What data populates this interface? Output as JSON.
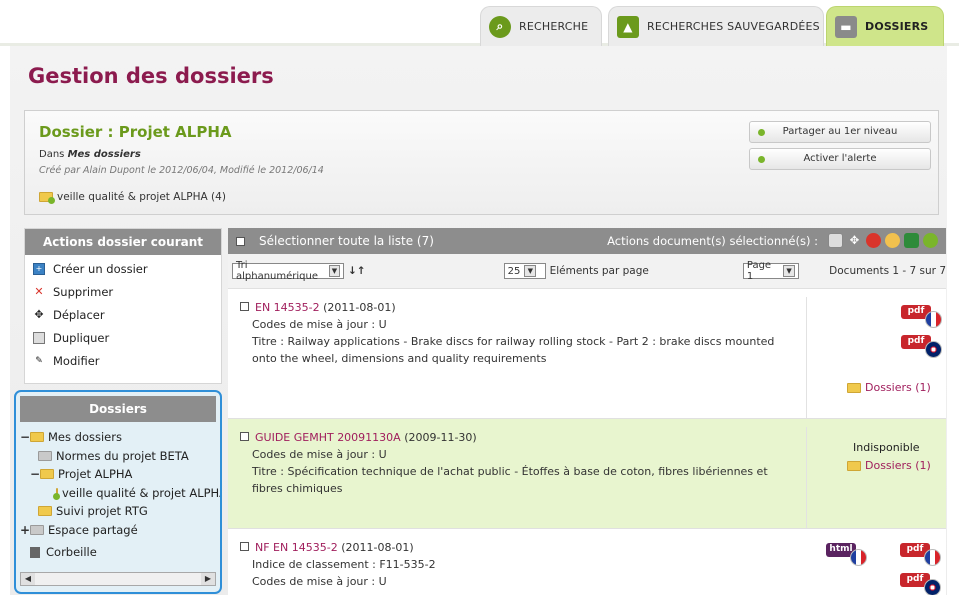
{
  "tabs": [
    {
      "label": "RECHERCHE",
      "icon": "search-icon"
    },
    {
      "label": "RECHERCHES SAUVEGARDÉES",
      "icon": "saved-search-icon"
    },
    {
      "label": "DOSSIERS",
      "icon": "folder-icon",
      "active": true
    }
  ],
  "page_title": "Gestion des dossiers",
  "dossier": {
    "title": "Dossier : Projet ALPHA",
    "location_prefix": "Dans",
    "location": "Mes dossiers",
    "created": "Créé par Alain Dupont le 2012/06/04, Modifié le 2012/06/14",
    "subfolder": "veille qualité & projet ALPHA (4)",
    "share_button": "Partager au 1er niveau",
    "alert_button": "Activer l'alerte"
  },
  "actions_panel": {
    "title": "Actions dossier courant",
    "items": [
      {
        "label": "Créer un dossier",
        "icon": "create-folder-icon"
      },
      {
        "label": "Supprimer",
        "icon": "delete-icon"
      },
      {
        "label": "Déplacer",
        "icon": "move-icon"
      },
      {
        "label": "Dupliquer",
        "icon": "duplicate-icon"
      },
      {
        "label": "Modifier",
        "icon": "edit-icon"
      }
    ]
  },
  "dossiers_panel": {
    "title": "Dossiers",
    "tree": [
      {
        "label": "Mes dossiers",
        "toggle": "−"
      },
      {
        "label": "Normes du projet BETA",
        "toggle": ""
      },
      {
        "label": "Projet ALPHA",
        "toggle": "−"
      },
      {
        "label": "veille qualité & projet ALPHA",
        "toggle": ""
      },
      {
        "label": "Suivi projet RTG",
        "toggle": ""
      },
      {
        "label": "Espace partagé",
        "toggle": "+"
      },
      {
        "label": "Corbeille",
        "toggle": ""
      }
    ]
  },
  "list": {
    "select_all": "Sélectionner toute la liste (7)",
    "selected_actions": "Actions document(s) sélectionné(s) :",
    "sort": "Tri alphanumérique",
    "per_page_value": "25",
    "per_page_label": "Eléments par page",
    "page": "Page 1",
    "count": "Documents 1 - 7 sur 7"
  },
  "documents": [
    {
      "ref": "EN 14535-2",
      "date": "(2011-08-01)",
      "line2": "Codes de mise à jour : U",
      "line3": "Titre : Railway applications - Brake discs for railway rolling stock - Part 2 : brake discs mounted onto the wheel, dimensions and quality requirements",
      "status": "",
      "dossiers": "Dossiers (1)",
      "formats": [
        "pdf",
        "pdf"
      ]
    },
    {
      "ref": "GUIDE GEMHT 20091130A",
      "date": "(2009-11-30)",
      "line2": "Codes de mise à jour : U",
      "line3": "Titre : Spécification technique de l'achat public - Étoffes à base de coton, fibres libériennes et fibres chimiques",
      "status": "Indisponible",
      "dossiers": "Dossiers (1)",
      "formats": []
    },
    {
      "ref": "NF EN 14535-2",
      "date": "(2011-08-01)",
      "line2": "Indice de classement : F11-535-2",
      "line3": "Codes de mise à jour : U",
      "status": "",
      "dossiers": "",
      "formats": [
        "html",
        "pdf",
        "pdf"
      ]
    }
  ],
  "colors": {
    "accent": "#8c1b4e",
    "green": "#6b9a1c",
    "tab_active": "#cfe58a",
    "highlight_row": "#e8f5cf"
  }
}
